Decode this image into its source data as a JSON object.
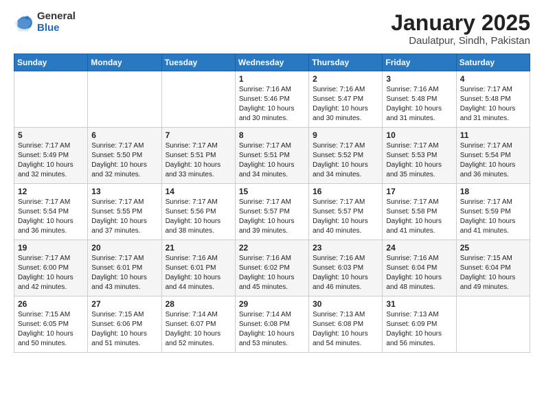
{
  "logo": {
    "general": "General",
    "blue": "Blue"
  },
  "title": "January 2025",
  "subtitle": "Daulatpur, Sindh, Pakistan",
  "headers": [
    "Sunday",
    "Monday",
    "Tuesday",
    "Wednesday",
    "Thursday",
    "Friday",
    "Saturday"
  ],
  "weeks": [
    [
      {
        "day": "",
        "info": ""
      },
      {
        "day": "",
        "info": ""
      },
      {
        "day": "",
        "info": ""
      },
      {
        "day": "1",
        "info": "Sunrise: 7:16 AM\nSunset: 5:46 PM\nDaylight: 10 hours\nand 30 minutes."
      },
      {
        "day": "2",
        "info": "Sunrise: 7:16 AM\nSunset: 5:47 PM\nDaylight: 10 hours\nand 30 minutes."
      },
      {
        "day": "3",
        "info": "Sunrise: 7:16 AM\nSunset: 5:48 PM\nDaylight: 10 hours\nand 31 minutes."
      },
      {
        "day": "4",
        "info": "Sunrise: 7:17 AM\nSunset: 5:48 PM\nDaylight: 10 hours\nand 31 minutes."
      }
    ],
    [
      {
        "day": "5",
        "info": "Sunrise: 7:17 AM\nSunset: 5:49 PM\nDaylight: 10 hours\nand 32 minutes."
      },
      {
        "day": "6",
        "info": "Sunrise: 7:17 AM\nSunset: 5:50 PM\nDaylight: 10 hours\nand 32 minutes."
      },
      {
        "day": "7",
        "info": "Sunrise: 7:17 AM\nSunset: 5:51 PM\nDaylight: 10 hours\nand 33 minutes."
      },
      {
        "day": "8",
        "info": "Sunrise: 7:17 AM\nSunset: 5:51 PM\nDaylight: 10 hours\nand 34 minutes."
      },
      {
        "day": "9",
        "info": "Sunrise: 7:17 AM\nSunset: 5:52 PM\nDaylight: 10 hours\nand 34 minutes."
      },
      {
        "day": "10",
        "info": "Sunrise: 7:17 AM\nSunset: 5:53 PM\nDaylight: 10 hours\nand 35 minutes."
      },
      {
        "day": "11",
        "info": "Sunrise: 7:17 AM\nSunset: 5:54 PM\nDaylight: 10 hours\nand 36 minutes."
      }
    ],
    [
      {
        "day": "12",
        "info": "Sunrise: 7:17 AM\nSunset: 5:54 PM\nDaylight: 10 hours\nand 36 minutes."
      },
      {
        "day": "13",
        "info": "Sunrise: 7:17 AM\nSunset: 5:55 PM\nDaylight: 10 hours\nand 37 minutes."
      },
      {
        "day": "14",
        "info": "Sunrise: 7:17 AM\nSunset: 5:56 PM\nDaylight: 10 hours\nand 38 minutes."
      },
      {
        "day": "15",
        "info": "Sunrise: 7:17 AM\nSunset: 5:57 PM\nDaylight: 10 hours\nand 39 minutes."
      },
      {
        "day": "16",
        "info": "Sunrise: 7:17 AM\nSunset: 5:57 PM\nDaylight: 10 hours\nand 40 minutes."
      },
      {
        "day": "17",
        "info": "Sunrise: 7:17 AM\nSunset: 5:58 PM\nDaylight: 10 hours\nand 41 minutes."
      },
      {
        "day": "18",
        "info": "Sunrise: 7:17 AM\nSunset: 5:59 PM\nDaylight: 10 hours\nand 41 minutes."
      }
    ],
    [
      {
        "day": "19",
        "info": "Sunrise: 7:17 AM\nSunset: 6:00 PM\nDaylight: 10 hours\nand 42 minutes."
      },
      {
        "day": "20",
        "info": "Sunrise: 7:17 AM\nSunset: 6:01 PM\nDaylight: 10 hours\nand 43 minutes."
      },
      {
        "day": "21",
        "info": "Sunrise: 7:16 AM\nSunset: 6:01 PM\nDaylight: 10 hours\nand 44 minutes."
      },
      {
        "day": "22",
        "info": "Sunrise: 7:16 AM\nSunset: 6:02 PM\nDaylight: 10 hours\nand 45 minutes."
      },
      {
        "day": "23",
        "info": "Sunrise: 7:16 AM\nSunset: 6:03 PM\nDaylight: 10 hours\nand 46 minutes."
      },
      {
        "day": "24",
        "info": "Sunrise: 7:16 AM\nSunset: 6:04 PM\nDaylight: 10 hours\nand 48 minutes."
      },
      {
        "day": "25",
        "info": "Sunrise: 7:15 AM\nSunset: 6:04 PM\nDaylight: 10 hours\nand 49 minutes."
      }
    ],
    [
      {
        "day": "26",
        "info": "Sunrise: 7:15 AM\nSunset: 6:05 PM\nDaylight: 10 hours\nand 50 minutes."
      },
      {
        "day": "27",
        "info": "Sunrise: 7:15 AM\nSunset: 6:06 PM\nDaylight: 10 hours\nand 51 minutes."
      },
      {
        "day": "28",
        "info": "Sunrise: 7:14 AM\nSunset: 6:07 PM\nDaylight: 10 hours\nand 52 minutes."
      },
      {
        "day": "29",
        "info": "Sunrise: 7:14 AM\nSunset: 6:08 PM\nDaylight: 10 hours\nand 53 minutes."
      },
      {
        "day": "30",
        "info": "Sunrise: 7:13 AM\nSunset: 6:08 PM\nDaylight: 10 hours\nand 54 minutes."
      },
      {
        "day": "31",
        "info": "Sunrise: 7:13 AM\nSunset: 6:09 PM\nDaylight: 10 hours\nand 56 minutes."
      },
      {
        "day": "",
        "info": ""
      }
    ]
  ]
}
